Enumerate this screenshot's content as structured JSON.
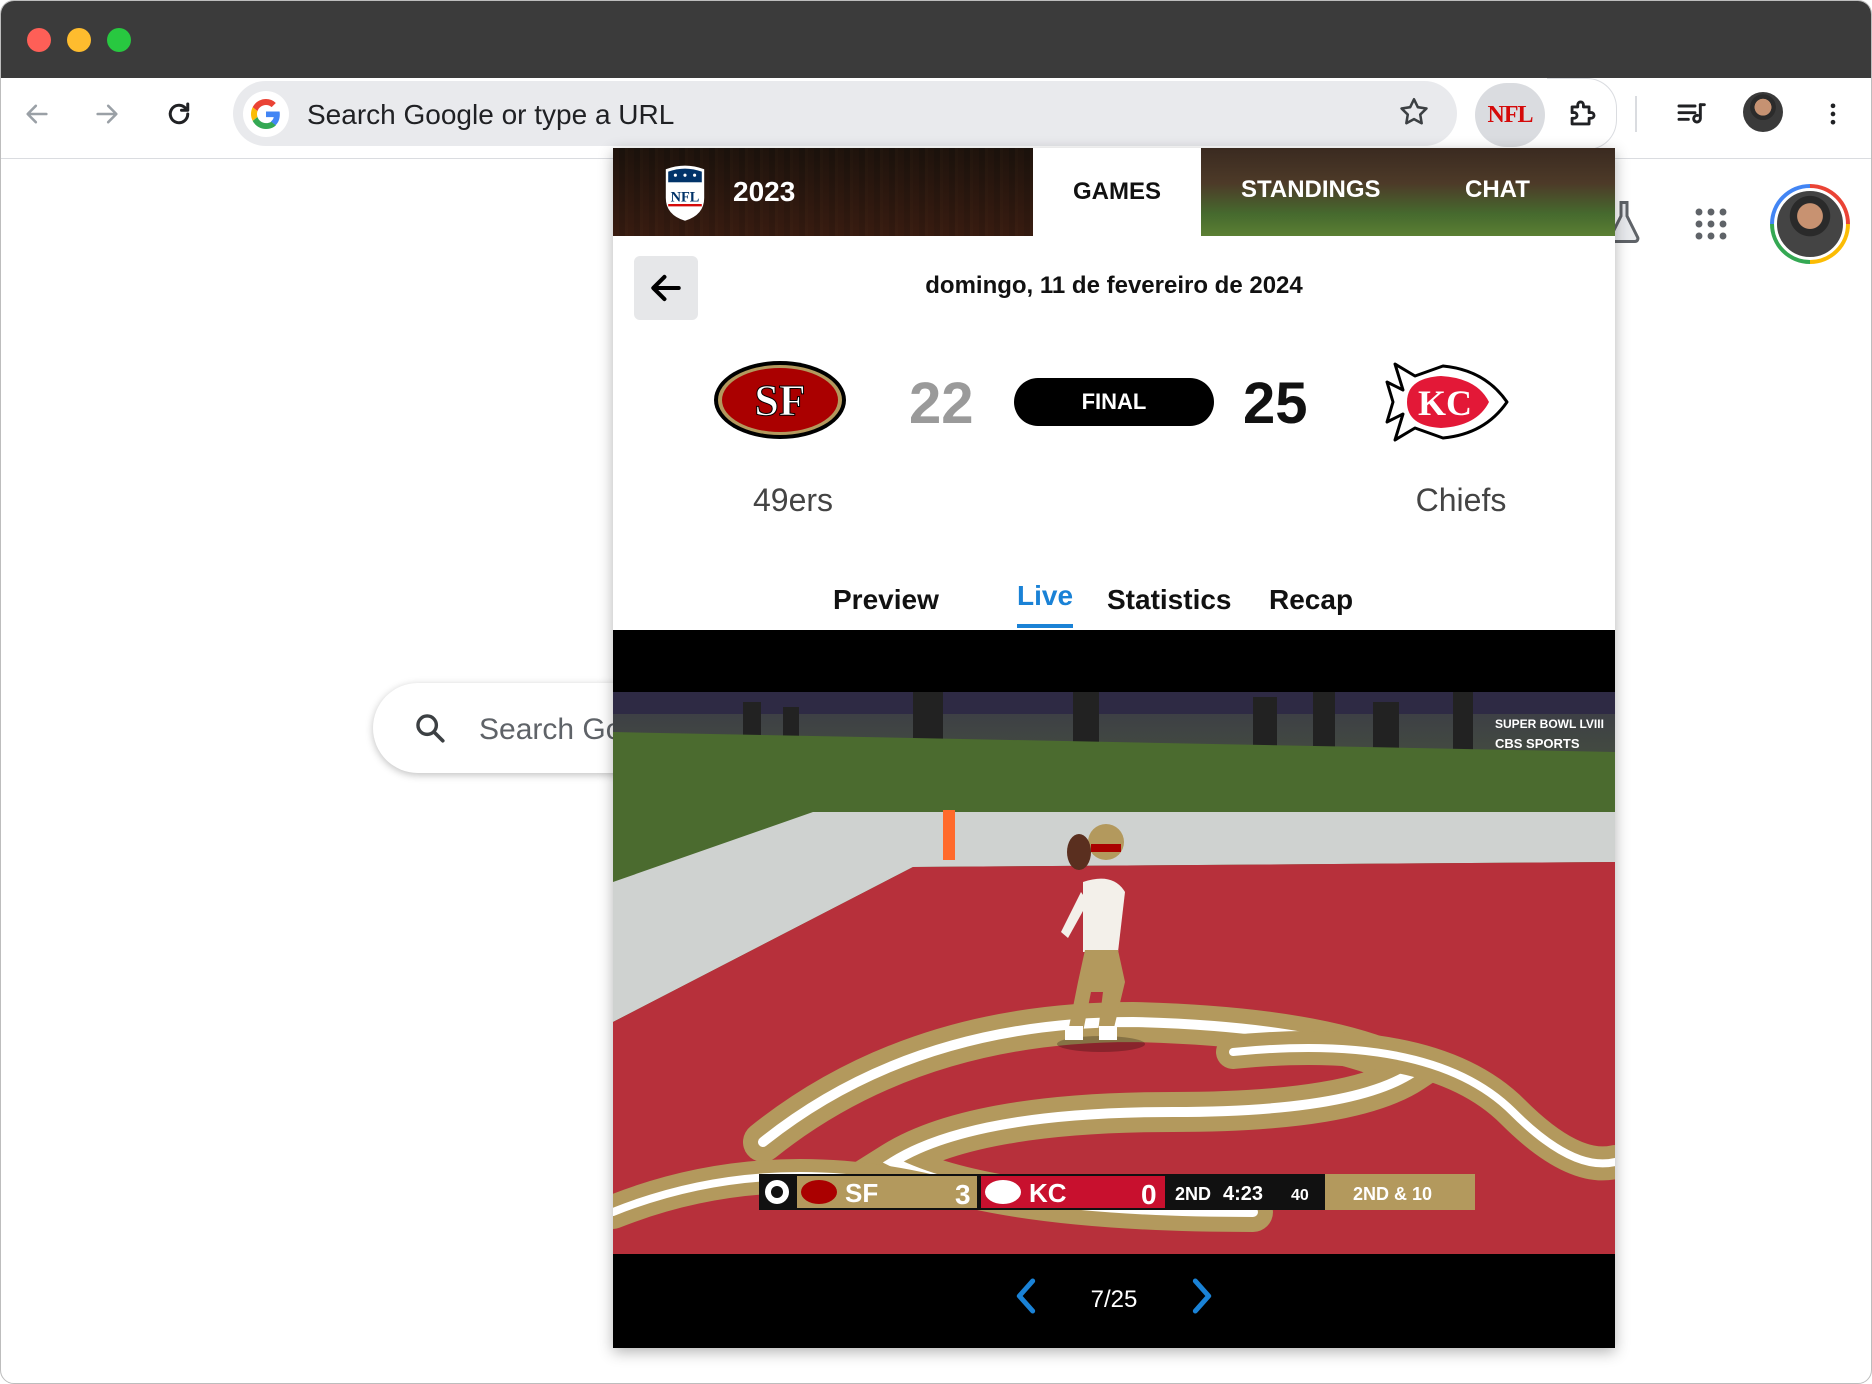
{
  "browser": {
    "omnibox_placeholder": "Search Google or type a URL",
    "extension_label": "NFL"
  },
  "ntp": {
    "search_placeholder": "Search Google"
  },
  "popup": {
    "header": {
      "season": "2023",
      "tabs": [
        {
          "label": "GAMES",
          "active": true
        },
        {
          "label": "STANDINGS",
          "active": false
        },
        {
          "label": "CHAT",
          "active": false
        }
      ]
    },
    "game": {
      "date": "domingo, 11 de fevereiro de 2024",
      "home": {
        "name": "49ers",
        "abbr": "SF",
        "score": "22",
        "color": "#aa0000"
      },
      "away": {
        "name": "Chiefs",
        "abbr": "KC",
        "score": "25",
        "color": "#e31837"
      },
      "status": "FINAL"
    },
    "subtabs": [
      {
        "label": "Preview",
        "active": false
      },
      {
        "label": "Live",
        "active": true
      },
      {
        "label": "Statistics",
        "active": false
      },
      {
        "label": "Recap",
        "active": false
      }
    ],
    "video": {
      "broadcast_bug": "SUPER BOWL LVIII",
      "network": "CBS SPORTS",
      "scorebug": {
        "team1": "SF",
        "team1_score": "3",
        "team2": "KC",
        "team2_score": "0",
        "quarter": "2ND",
        "clock": "4:23",
        "play_clock": "40",
        "down": "2ND & 10"
      }
    },
    "pager": {
      "current": 7,
      "total": 25,
      "label": "7/25"
    }
  },
  "colors": {
    "accent": "#1a82d6",
    "niners_gold": "#b3995d"
  }
}
